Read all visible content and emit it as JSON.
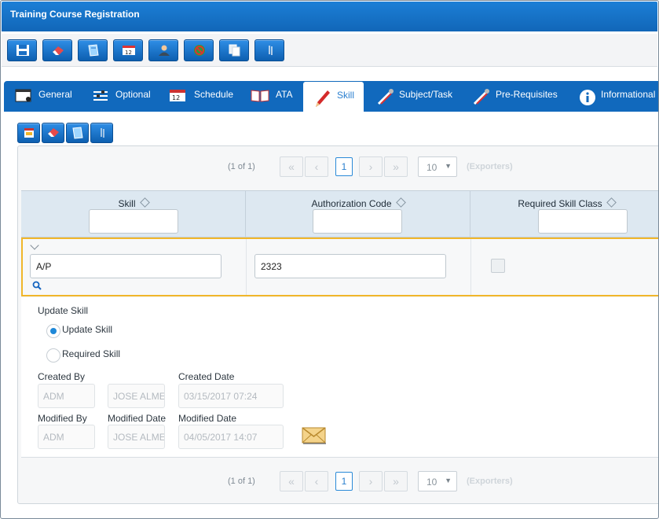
{
  "window": {
    "title": "Training Course Registration"
  },
  "toolbar": {
    "buttons": [
      {
        "name": "save-button",
        "icon": "floppy-disk-icon"
      },
      {
        "name": "eraser-button",
        "icon": "eraser-icon"
      },
      {
        "name": "edit-button",
        "icon": "notepad-edit-icon"
      },
      {
        "name": "calendar-button",
        "icon": "calendar-icon"
      },
      {
        "name": "user-button",
        "icon": "user-icon"
      },
      {
        "name": "no-entry-button",
        "icon": "no-entry-icon"
      },
      {
        "name": "copy-button",
        "icon": "copy-pages-icon"
      },
      {
        "name": "attachment-button",
        "icon": "paperclip-icon"
      }
    ]
  },
  "tabs": [
    {
      "label": "General",
      "icon": "window-icon"
    },
    {
      "label": "Optional",
      "icon": "sliders-icon"
    },
    {
      "label": "Schedule",
      "icon": "calendar-icon"
    },
    {
      "label": "ATA",
      "icon": "book-icon"
    },
    {
      "label": "Skill",
      "icon": "pen-icon",
      "active": true
    },
    {
      "label": "Subject/Task",
      "icon": "tools-icon"
    },
    {
      "label": "Pre-Requisites",
      "icon": "tools-icon"
    },
    {
      "label": "Informational",
      "icon": "info-icon"
    }
  ],
  "subtoolbar": {
    "buttons": [
      {
        "name": "new-row-button",
        "icon": "new-record-icon"
      },
      {
        "name": "eraser-button",
        "icon": "eraser-icon"
      },
      {
        "name": "edit-button",
        "icon": "notepad-edit-icon"
      },
      {
        "name": "attachment-button",
        "icon": "paperclip-icon"
      }
    ]
  },
  "pager": {
    "count_text": "(1 of 1)",
    "current_page": "1",
    "page_size": "10",
    "export_label": "(Exporters)",
    "first_glyph": "«",
    "prev_glyph": "‹",
    "next_glyph": "›",
    "last_glyph": "»"
  },
  "grid": {
    "columns": [
      "Skill",
      "Authorization Code",
      "Required Skill Class"
    ],
    "row": {
      "skill": "A/P",
      "authorization_code": "2323",
      "required_skill_class": false
    }
  },
  "detail": {
    "section_label": "Update Skill",
    "radio_options": [
      {
        "label": "Update Skill",
        "selected": true
      },
      {
        "label": "Required Skill",
        "selected": false
      }
    ],
    "created_by_label": "Created By",
    "created_by_code": "ADM",
    "created_by_name": "JOSE ALMEI",
    "created_date_label": "Created Date",
    "created_date": "03/15/2017 07:24",
    "modified_by_label": "Modified By",
    "modified_by_code": "ADM",
    "modified_date_name_label": "Modified Date",
    "modified_by_name": "JOSE ALMEI",
    "modified_date_label": "Modified Date",
    "modified_date": "04/05/2017 14:07"
  },
  "colors": {
    "brand_blue": "#1169bd",
    "row_highlight": "#f0b62a",
    "accent": "#2a7fcf"
  }
}
